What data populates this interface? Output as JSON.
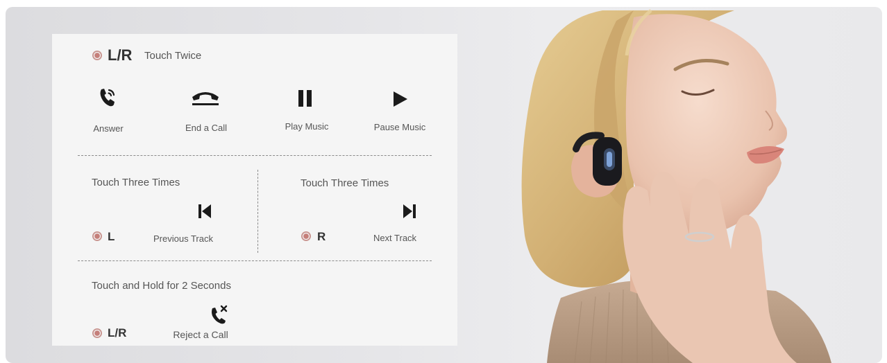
{
  "colors": {
    "background": "#e4e4e7",
    "card": "#f5f5f5",
    "indicator_dot": "#c57f7a",
    "icon": "#1b1b1b",
    "text": "#555555"
  },
  "section_twice": {
    "side": "L/R",
    "action": "Touch Twice",
    "functions": [
      {
        "icon": "phone-ringing-icon",
        "label": "Answer"
      },
      {
        "icon": "hang-up-icon",
        "label": "End a Call"
      },
      {
        "icon": "pause-icon",
        "label": "Play Music"
      },
      {
        "icon": "play-icon",
        "label": "Pause Music"
      }
    ]
  },
  "section_three_left": {
    "action": "Touch Three Times",
    "side": "L",
    "icon": "previous-track-icon",
    "label": "Previous Track"
  },
  "section_three_right": {
    "action": "Touch Three Times",
    "side": "R",
    "icon": "next-track-icon",
    "label": "Next Track"
  },
  "section_hold": {
    "action": "Touch and Hold for 2 Seconds",
    "side": "L/R",
    "icon": "reject-call-icon",
    "label": "Reject a Call"
  },
  "photo": {
    "subject": "woman-wearing-open-ear-earbud"
  }
}
